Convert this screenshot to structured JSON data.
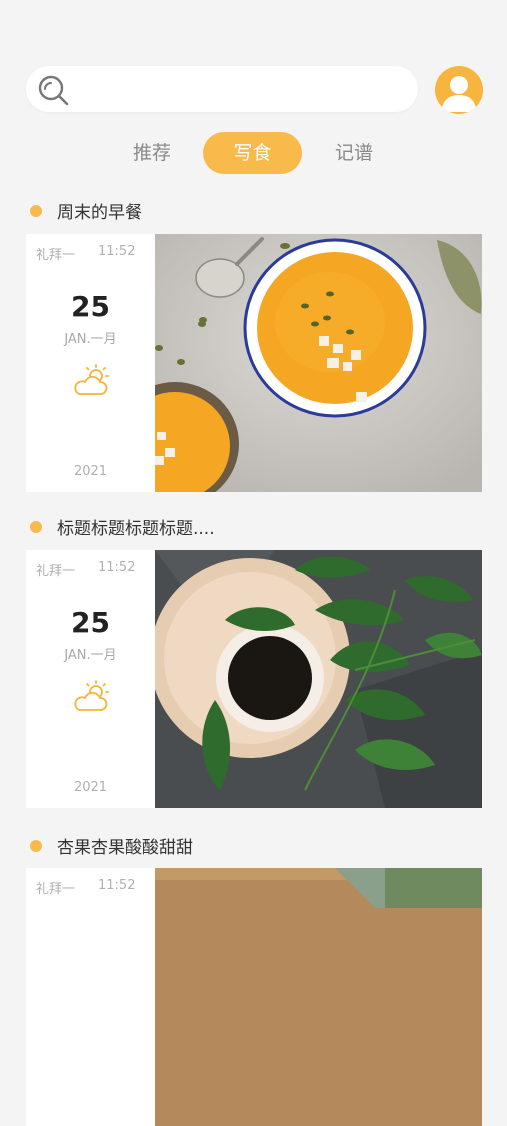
{
  "search": {
    "placeholder": ""
  },
  "tabs": [
    {
      "label": "推荐"
    },
    {
      "label": "写食"
    },
    {
      "label": "记谱"
    }
  ],
  "active_tab": "写食",
  "accent_color": "#f8bb4b",
  "posts": [
    {
      "title": "周末的早餐",
      "weekday": "礼拜一",
      "time": "11:52",
      "day": "25",
      "month": "JAN.一月",
      "year": "2021",
      "weather_icon": "sunny-cloud-icon",
      "photo": "pumpkin-soup-photo"
    },
    {
      "title": "标题标题标题标题....",
      "weekday": "礼拜一",
      "time": "11:52",
      "day": "25",
      "month": "JAN.一月",
      "year": "2021",
      "weather_icon": "sunny-cloud-icon",
      "photo": "coffee-plant-photo"
    },
    {
      "title": "杏果杏果酸酸甜甜",
      "weekday": "礼拜一",
      "time": "11:52",
      "photo": "wood-table-photo"
    }
  ]
}
